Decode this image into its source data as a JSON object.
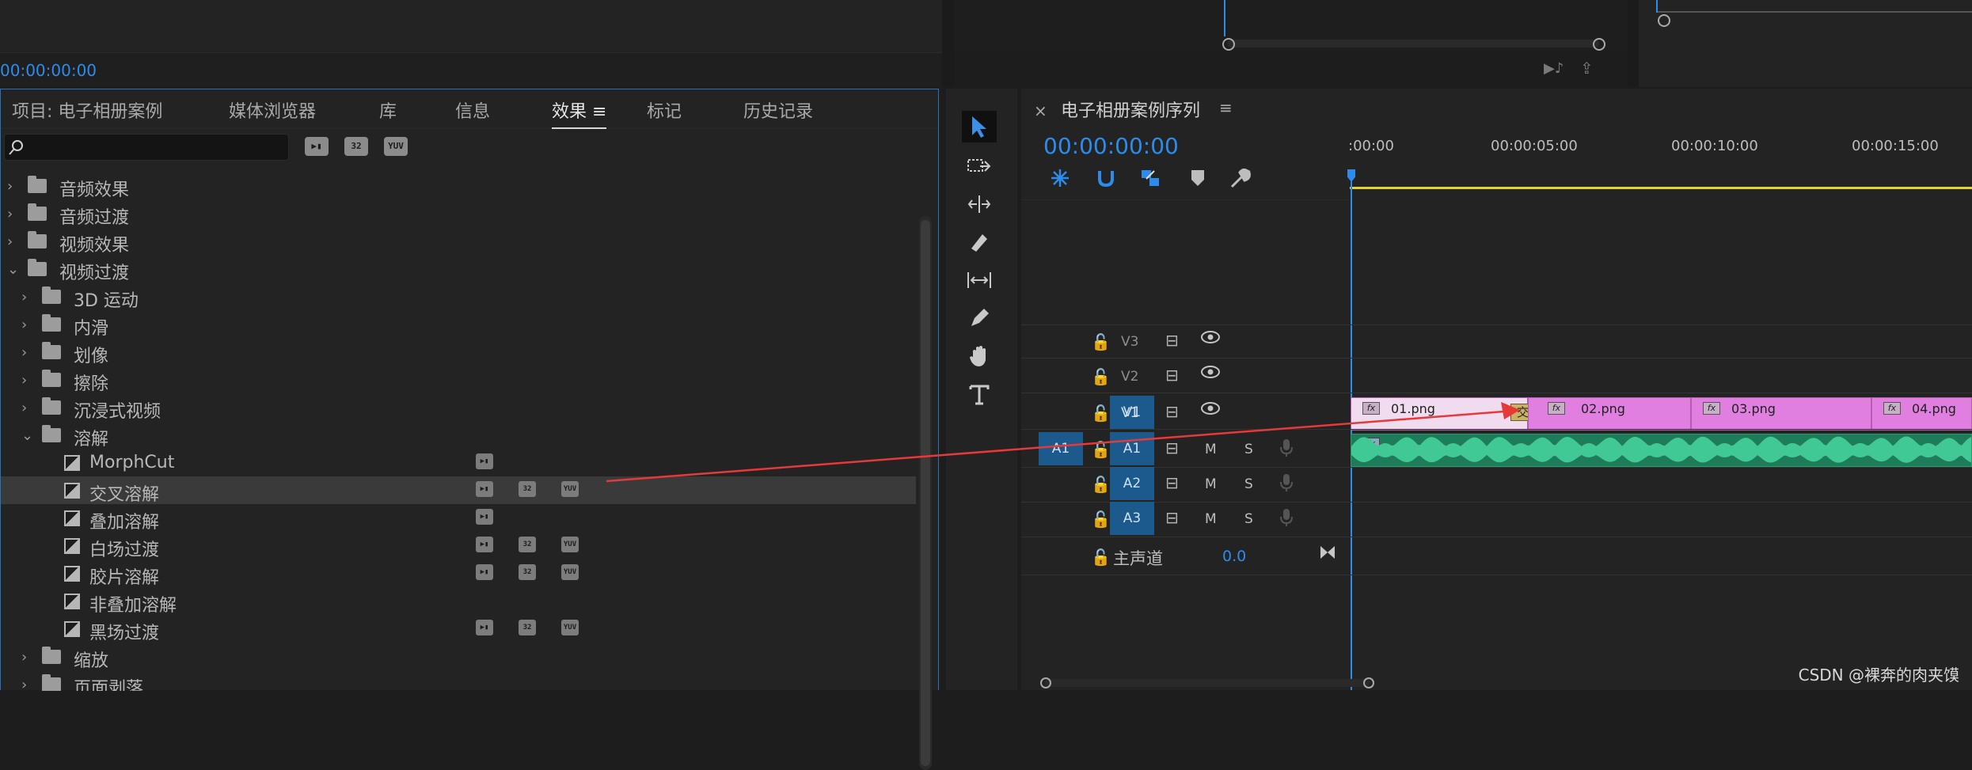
{
  "program_monitor": {
    "timecode": "00:00:00:00"
  },
  "effects_panel": {
    "tabs": [
      {
        "label": "项目: 电子相册案例"
      },
      {
        "label": "媒体浏览器"
      },
      {
        "label": "库"
      },
      {
        "label": "信息"
      },
      {
        "label": "效果"
      },
      {
        "label": "标记"
      },
      {
        "label": "历史记录"
      }
    ],
    "tab_menu": "≡",
    "search_placeholder": "",
    "filter_badges": [
      "32",
      "YUV"
    ],
    "tree": [
      {
        "label": "音频效果",
        "type": "folder",
        "level": 0,
        "open": false
      },
      {
        "label": "音频过渡",
        "type": "folder",
        "level": 0,
        "open": false
      },
      {
        "label": "视频效果",
        "type": "folder",
        "level": 0,
        "open": false
      },
      {
        "label": "视频过渡",
        "type": "folder",
        "level": 0,
        "open": true
      },
      {
        "label": "3D 运动",
        "type": "folder",
        "level": 1,
        "open": false
      },
      {
        "label": "内滑",
        "type": "folder",
        "level": 1,
        "open": false
      },
      {
        "label": "划像",
        "type": "folder",
        "level": 1,
        "open": false
      },
      {
        "label": "擦除",
        "type": "folder",
        "level": 1,
        "open": false
      },
      {
        "label": "沉浸式视频",
        "type": "folder",
        "level": 1,
        "open": false
      },
      {
        "label": "溶解",
        "type": "folder",
        "level": 1,
        "open": true
      },
      {
        "label": "MorphCut",
        "type": "effect",
        "badges": [
          "acc"
        ]
      },
      {
        "label": "交叉溶解",
        "type": "effect",
        "badges": [
          "acc",
          "32",
          "YUV"
        ],
        "selected": true
      },
      {
        "label": "叠加溶解",
        "type": "effect",
        "badges": [
          "acc"
        ]
      },
      {
        "label": "白场过渡",
        "type": "effect",
        "badges": [
          "acc",
          "32",
          "YUV"
        ]
      },
      {
        "label": "胶片溶解",
        "type": "effect",
        "badges": [
          "acc",
          "32",
          "YUV"
        ]
      },
      {
        "label": "非叠加溶解",
        "type": "effect",
        "badges": []
      },
      {
        "label": "黑场过渡",
        "type": "effect",
        "badges": [
          "acc",
          "32",
          "YUV"
        ]
      },
      {
        "label": "缩放",
        "type": "folder",
        "level": 1,
        "open": false
      },
      {
        "label": "页面剥落",
        "type": "folder",
        "level": 1,
        "open": false
      }
    ]
  },
  "timeline": {
    "close": "×",
    "sequence_name": "电子相册案例序列",
    "menu": "≡",
    "timecode": "00:00:00:00",
    "ruler": [
      ":00:00",
      "00:00:05:00",
      "00:00:10:00",
      "00:00:15:00"
    ],
    "video_tracks": [
      {
        "name": "V3",
        "src": ""
      },
      {
        "name": "V2",
        "src": ""
      },
      {
        "name": "V1",
        "src": "V1"
      }
    ],
    "audio_tracks": [
      {
        "name": "A1",
        "src": "A1",
        "m": "M",
        "s": "S"
      },
      {
        "name": "A2",
        "src": "",
        "m": "M",
        "s": "S"
      },
      {
        "name": "A3",
        "src": "",
        "m": "M",
        "s": "S"
      }
    ],
    "master": {
      "label": "主声道",
      "value": "0.0"
    },
    "clips": [
      {
        "name": "01.png",
        "fx": "fx"
      },
      {
        "name": "02.png",
        "fx": "fx"
      },
      {
        "name": "03.png",
        "fx": "fx"
      },
      {
        "name": "04.png",
        "fx": "fx"
      }
    ],
    "transition_label": "交叉",
    "audio_fx": "fx"
  },
  "watermark": "CSDN @裸奔的肉夹馍",
  "colors": {
    "accent": "#2d8ceb",
    "clip": "#e07fe0",
    "audio": "#2f9a71",
    "arrow": "#e5393a",
    "track_button": "#1c5a8d"
  }
}
